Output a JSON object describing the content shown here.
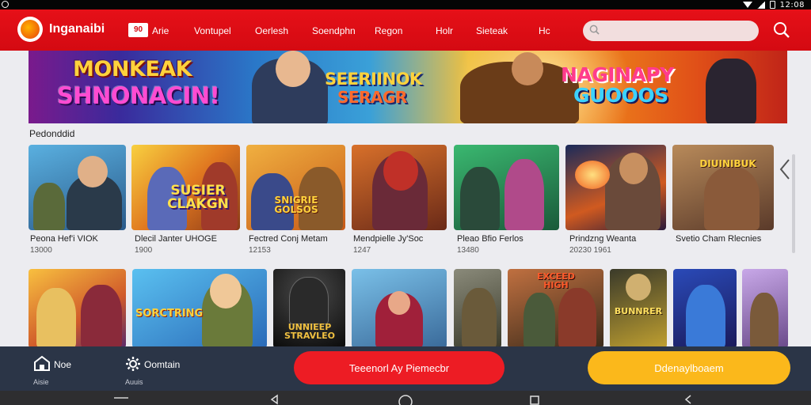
{
  "status_bar": {
    "time": "12:08"
  },
  "header": {
    "brand": "Inganaibi",
    "badge": "90",
    "nav": [
      "Arie",
      "Vontupel",
      "Oerlesh",
      "Soendphn",
      "Regon",
      "Holr",
      "Sieteak",
      "Hc"
    ],
    "search": {
      "placeholder": ""
    }
  },
  "banner": {
    "line1": "MONKEAK",
    "line2": "SHNONACIN!",
    "line3": "SEERIINOK",
    "line4": "SERAGR",
    "line5": "NAGINAPY",
    "line6": "GUOOOS"
  },
  "section": {
    "title": "Pedonddid"
  },
  "games_row1": [
    {
      "name": "Peona Hef'i VIOK",
      "meta": "13000",
      "logo": ""
    },
    {
      "name": "Dlecil Janter UHOGE",
      "meta": "1900",
      "logo": "SUSIER CLAKGN"
    },
    {
      "name": "Fectred Conj Metam",
      "meta": "12153",
      "logo": "SNIGRIE GOLSOS"
    },
    {
      "name": "Mendpielle Jy'Soc",
      "meta": "1247",
      "logo": ""
    },
    {
      "name": "Pleao Bfio Ferlos",
      "meta": "13480",
      "logo": ""
    },
    {
      "name": "Prindzng Weanta",
      "meta": "20230 1961",
      "logo": ""
    },
    {
      "name": "Svetio Cham Rlecnies",
      "meta": "",
      "logo": "DIUINIBUK"
    }
  ],
  "games_row2": [
    {
      "logo": ""
    },
    {
      "logo": "SORCTRING"
    },
    {
      "logo": "UNNIEEP STRAVLEO"
    },
    {
      "logo": ""
    },
    {
      "logo": ""
    },
    {
      "logo": "EXCEED HIGH"
    },
    {
      "logo": "BUNNRER"
    },
    {
      "logo": ""
    },
    {
      "logo": ""
    }
  ],
  "bottom": {
    "home_label": "Noe",
    "home_sub": "Aisie",
    "settings_label": "Oomtain",
    "settings_sub": "Auuis",
    "red_button": "Teeenorl Ay Piemecbr",
    "yellow_button": "Ddenaylboaem"
  },
  "colors": {
    "brand_red": "#d40a12",
    "accent_yellow": "#fbb81b",
    "bottom_bar": "#2b3547"
  }
}
